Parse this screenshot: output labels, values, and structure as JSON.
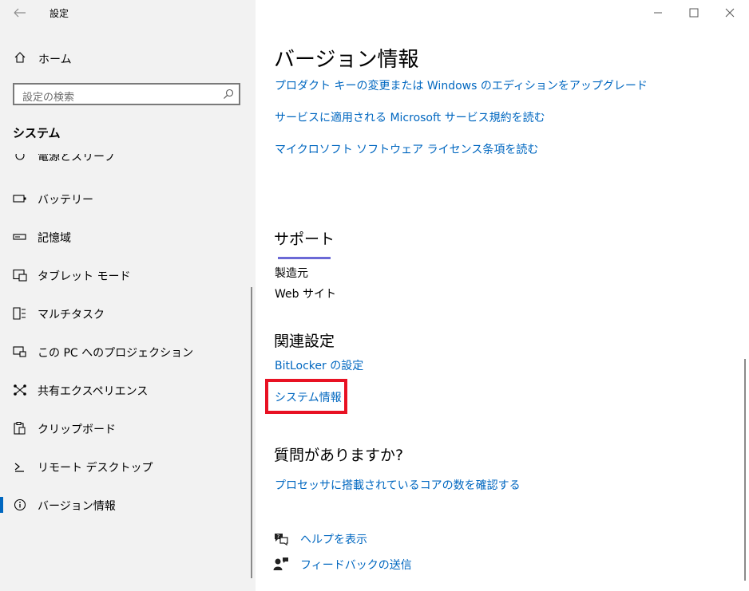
{
  "app": {
    "title": "設定"
  },
  "sidebar": {
    "home_label": "ホーム",
    "search_placeholder": "設定の検索",
    "section_title": "システム",
    "partial_item_label": "電源とスリープ",
    "items": [
      {
        "label": "バッテリー",
        "icon": "battery-icon"
      },
      {
        "label": "記憶域",
        "icon": "storage-icon"
      },
      {
        "label": "タブレット モード",
        "icon": "tablet-mode-icon"
      },
      {
        "label": "マルチタスク",
        "icon": "multitasking-icon"
      },
      {
        "label": "この PC へのプロジェクション",
        "icon": "projecting-icon"
      },
      {
        "label": "共有エクスペリエンス",
        "icon": "shared-experiences-icon"
      },
      {
        "label": "クリップボード",
        "icon": "clipboard-icon"
      },
      {
        "label": "リモート デスクトップ",
        "icon": "remote-desktop-icon"
      },
      {
        "label": "バージョン情報",
        "icon": "info-icon",
        "selected": true
      }
    ]
  },
  "main": {
    "title": "バージョン情報",
    "top_links": [
      "プロダクト キーの変更または Windows のエディションをアップグレード",
      "サービスに適用される Microsoft サービス規約を読む",
      "マイクロソフト ソフトウェア ライセンス条項を読む"
    ],
    "support": {
      "heading": "サポート",
      "manufacturer_label": "製造元",
      "website_label": "Web サイト"
    },
    "related": {
      "heading": "関連設定",
      "bitlocker_link": "BitLocker の設定",
      "system_info_link": "システム情報"
    },
    "questions": {
      "heading": "質問がありますか?",
      "link": "プロセッサに搭載されているコアの数を確認する"
    },
    "help": {
      "get_help": "ヘルプを表示",
      "feedback": "フィードバックの送信"
    }
  },
  "colors": {
    "accent": "#0067c0",
    "highlight": "#e81123",
    "sidebar_bg": "#f2f2f2"
  }
}
